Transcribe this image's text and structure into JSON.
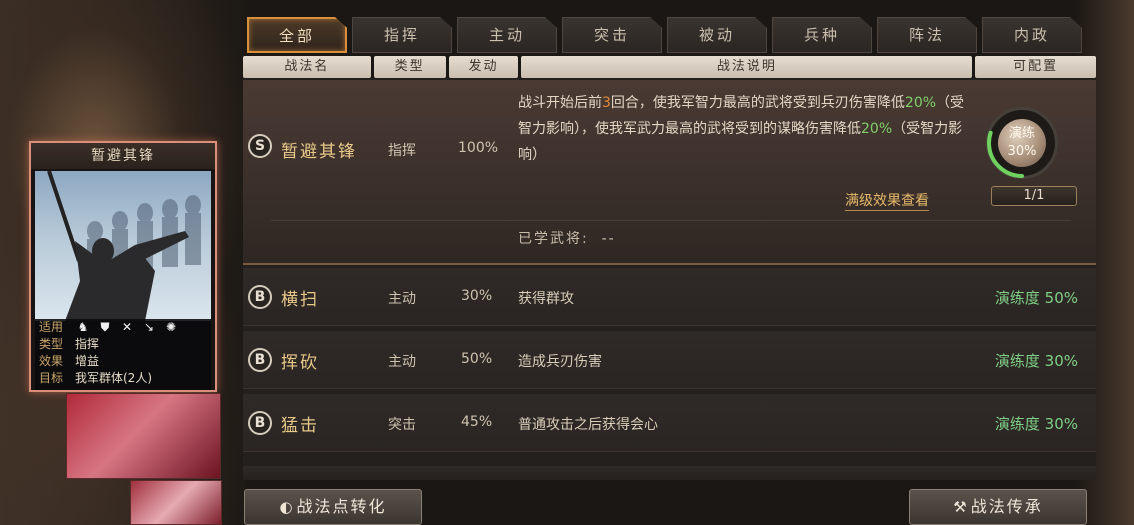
{
  "tabs": [
    "全部",
    "指挥",
    "主动",
    "突击",
    "被动",
    "兵种",
    "阵法",
    "内政"
  ],
  "columns": {
    "name": "战法名",
    "type": "类型",
    "rate": "发动",
    "desc": "战法说明",
    "config": "可配置"
  },
  "selected_skill": {
    "grade": "S",
    "name": "暂避其锋",
    "type": "指挥",
    "rate": "100%",
    "desc_part1": "战斗开始后前",
    "desc_rounds": "3",
    "desc_part2": "回合，使我军智力最高的武将受到兵刃伤害降低",
    "desc_pct1": "20%",
    "desc_part3": "（受智力影响），使我军武力最高的武将受到的谋略伤害降低",
    "desc_pct2": "20%",
    "desc_part4": "（受智力影响）",
    "full_effect_link": "满级效果查看",
    "learned_label": "已学武将:",
    "learned_value": "--",
    "practice_label": "演练",
    "practice_value": "30%",
    "practice_fraction": 0.3,
    "config_count": "1/1"
  },
  "preview_card": {
    "title": "暂避其锋",
    "arms_label": "适用",
    "arms_icons": [
      "cavalry-icon",
      "shield-icon",
      "bow-icon",
      "spear-icon",
      "siege-icon"
    ],
    "type_label": "类型",
    "type_value": "指挥",
    "effect_label": "效果",
    "effect_value": "增益",
    "target_label": "目标",
    "target_value": "我军群体(2人)"
  },
  "skills": [
    {
      "grade": "B",
      "name": "横扫",
      "type": "主动",
      "rate": "30%",
      "desc": "获得群攻",
      "practice": "演练度 50%"
    },
    {
      "grade": "B",
      "name": "挥砍",
      "type": "主动",
      "rate": "50%",
      "desc": "造成兵刃伤害",
      "practice": "演练度 30%"
    },
    {
      "grade": "B",
      "name": "猛击",
      "type": "突击",
      "rate": "45%",
      "desc": "普通攻击之后获得会心",
      "practice": "演练度 30%"
    }
  ],
  "buttons": {
    "convert": "战法点转化",
    "inherit": "战法传承"
  },
  "colors": {
    "accent_orange": "#e4893a",
    "accent_green": "#7fd06a",
    "tab_active_border": "#d9903d",
    "practice_green": "#7fcf86"
  }
}
